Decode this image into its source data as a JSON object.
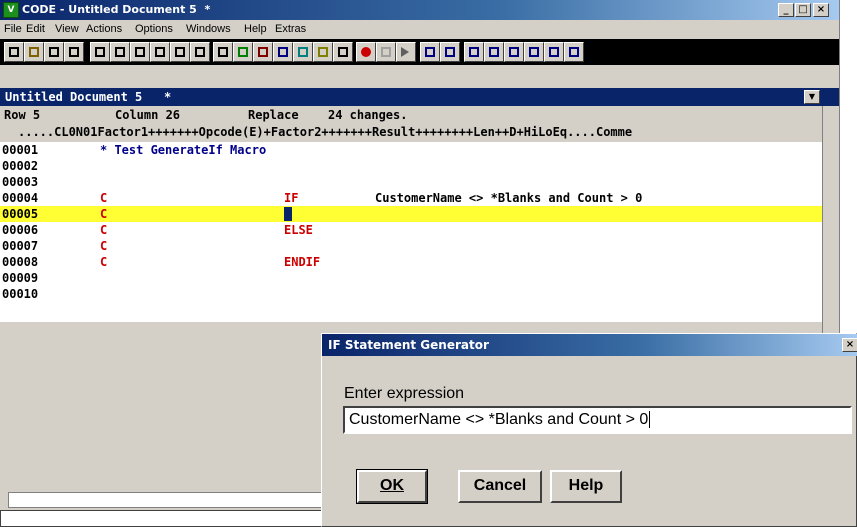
{
  "window": {
    "title": "CODE - Untitled Document 5  *",
    "icon": "app-icon",
    "controls": [
      "minimize-icon",
      "maximize-icon",
      "close-icon"
    ]
  },
  "menu": [
    "File",
    "Edit",
    "View",
    "Actions",
    "Options",
    "Windows",
    "Help",
    "Extras"
  ],
  "toolbar_icons": [
    "new-file-icon",
    "open-file-icon",
    "save-icon",
    "print-icon",
    "undo-icon",
    "redo-icon",
    "cut-icon",
    "copy-icon",
    "paste-icon",
    "cursor-icon",
    "find-icon",
    "verify-icon",
    "compile-icon",
    "build-icon",
    "debug-icon",
    "tools-icon",
    "run-icon",
    "record-icon",
    "stop-icon",
    "play-icon",
    "designer-icon",
    "grid-icon",
    "layout-icon",
    "toggle-icon",
    "back-icon",
    "forward-icon",
    "window-icon",
    "info-icon"
  ],
  "document": {
    "title": "Untitled Document 5   *",
    "status": {
      "row": "Row 5",
      "column": "Column 26",
      "mode": "Replace",
      "changes": "24 changes."
    },
    "ruler": ".....CL0N01Factor1+++++++Opcode(E)+Factor2+++++++Result++++++++Len++D+HiLoEq....Comme",
    "lines": [
      {
        "num": "00001",
        "cs": "",
        "op": "",
        "comment": "* Test GenerateIf Macro",
        "f2": ""
      },
      {
        "num": "00002",
        "cs": "",
        "op": "",
        "comment": "",
        "f2": ""
      },
      {
        "num": "00003",
        "cs": "",
        "op": "",
        "comment": "",
        "f2": ""
      },
      {
        "num": "00004",
        "cs": "C",
        "op": "IF",
        "comment": "",
        "f2": "CustomerName <> *Blanks and Count > 0"
      },
      {
        "num": "00005",
        "cs": "C",
        "op": "",
        "comment": "",
        "f2": ""
      },
      {
        "num": "00006",
        "cs": "C",
        "op": "ELSE",
        "comment": "",
        "f2": ""
      },
      {
        "num": "00007",
        "cs": "C",
        "op": "",
        "comment": "",
        "f2": ""
      },
      {
        "num": "00008",
        "cs": "C",
        "op": "ENDIF",
        "comment": "",
        "f2": ""
      },
      {
        "num": "00009",
        "cs": "",
        "op": "",
        "comment": "",
        "f2": ""
      },
      {
        "num": "00010",
        "cs": "",
        "op": "",
        "comment": "",
        "f2": ""
      }
    ],
    "highlight_line": 5,
    "colors": {
      "highlight": "#ffff33",
      "spec_code": "#cc0000",
      "comment": "#00008b"
    }
  },
  "dialog": {
    "title": "IF Statement Generator",
    "label": "Enter expression",
    "input_value": "CustomerName <> *Blanks and Count > 0",
    "ok": "OK",
    "cancel": "Cancel",
    "help": "Help"
  }
}
